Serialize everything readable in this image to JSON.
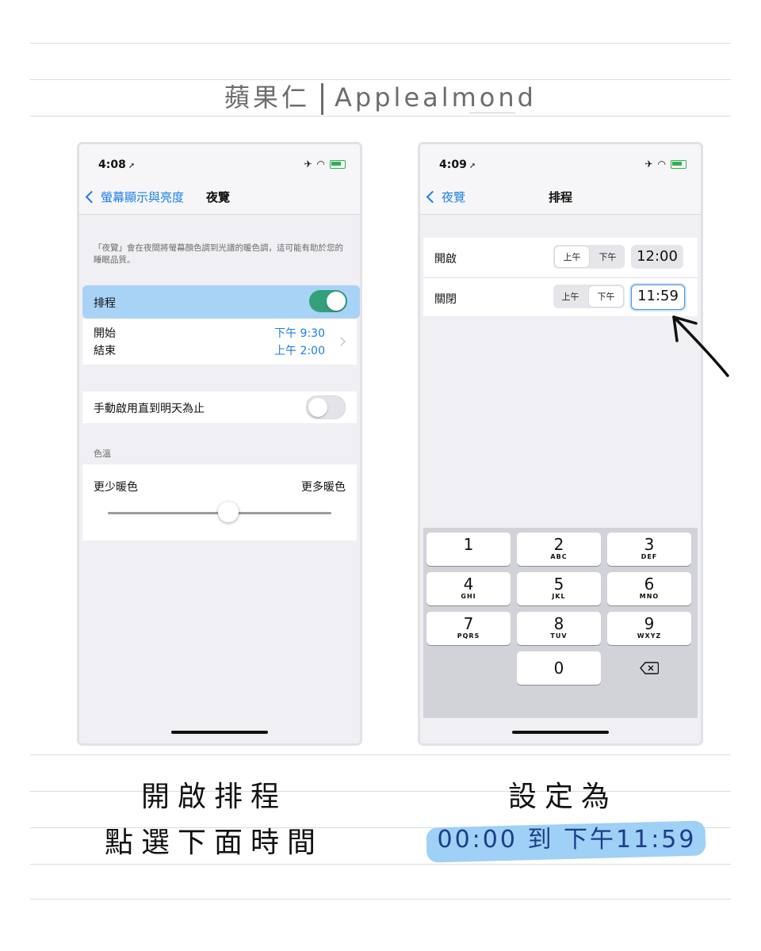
{
  "header": {
    "title_cn": "蘋果仁",
    "title_en": "Applealmond"
  },
  "left_phone": {
    "status": {
      "time": "4:08"
    },
    "nav": {
      "back_label": "螢幕顯示與亮度",
      "title": "夜覽"
    },
    "description": "「夜覽」會在夜間將螢幕顏色調到光譜的暖色調，這可能有助於您的睡眠品質。",
    "schedule": {
      "label": "排程",
      "toggle": "on"
    },
    "times": {
      "start_label": "開始",
      "end_label": "結束",
      "start_value": "下午 9:30",
      "end_value": "上午 2:00"
    },
    "manual": {
      "label": "手動啟用直到明天為止",
      "toggle": "off"
    },
    "color_temp": {
      "section": "色溫",
      "less": "更少暖色",
      "more": "更多暖色",
      "level": 0.54
    }
  },
  "right_phone": {
    "status": {
      "time": "4:09"
    },
    "nav": {
      "back_label": "夜覽",
      "title": "排程"
    },
    "rows": [
      {
        "label": "開啟",
        "am": "上午",
        "pm": "下午",
        "selected": "am",
        "time": "12:00"
      },
      {
        "label": "關閉",
        "am": "上午",
        "pm": "下午",
        "selected": "pm",
        "time": "11:59"
      }
    ],
    "keypad": {
      "keys": [
        {
          "num": "1",
          "letters": ""
        },
        {
          "num": "2",
          "letters": "ABC"
        },
        {
          "num": "3",
          "letters": "DEF"
        },
        {
          "num": "4",
          "letters": "GHI"
        },
        {
          "num": "5",
          "letters": "JKL"
        },
        {
          "num": "6",
          "letters": "MNO"
        },
        {
          "num": "7",
          "letters": "PQRS"
        },
        {
          "num": "8",
          "letters": "TUV"
        },
        {
          "num": "9",
          "letters": "WXYZ"
        },
        {
          "num": "0",
          "letters": ""
        }
      ]
    }
  },
  "captions": {
    "left_line1": "開啟排程",
    "left_line2": "點選下面時間",
    "right_line1": "設定為",
    "right_line2": "00:00 到 下午11:59"
  },
  "colors": {
    "accent": "#1a7ee6",
    "toggle_on": "#34a07a",
    "highlight": "#a9d2f7",
    "marker": "#9fd0f6"
  }
}
